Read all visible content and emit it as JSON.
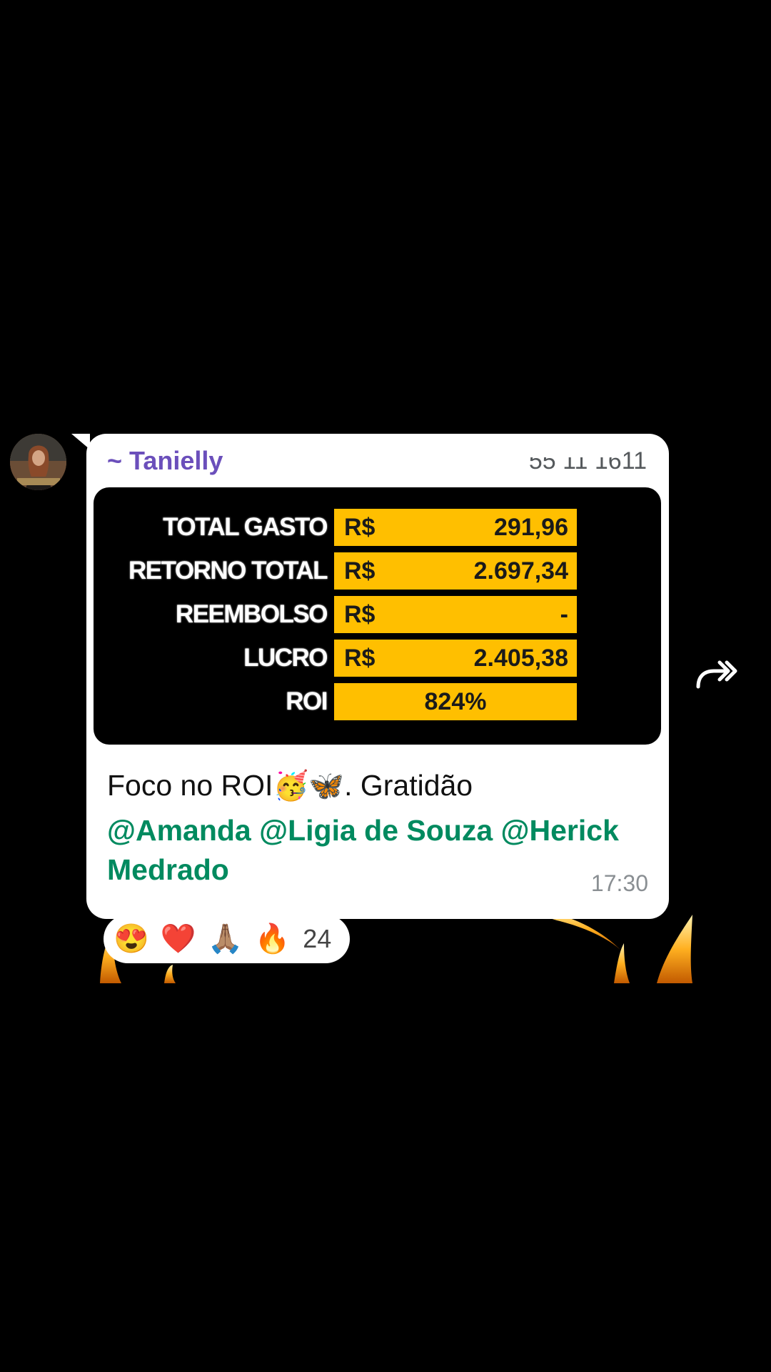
{
  "message": {
    "sender_visible": "~ Tanielly",
    "phone_fragment": "55 11 1611",
    "caption": "Foco no ROI",
    "caption_emojis": [
      "🥳",
      "🦋"
    ],
    "caption_suffix": ". Gratidão",
    "mentions": "@Amanda @Ligia de Souza @Herick Medrado",
    "time": "17:30"
  },
  "financial_table": {
    "rows": [
      {
        "label": "TOTAL GASTO",
        "currency": "R$",
        "value": "291,96"
      },
      {
        "label": "RETORNO TOTAL",
        "currency": "R$",
        "value": "2.697,34"
      },
      {
        "label": "REEMBOLSO",
        "currency": "R$",
        "value": "-"
      },
      {
        "label": "LUCRO",
        "currency": "R$",
        "value": "2.405,38"
      },
      {
        "label": "ROI",
        "currency": "",
        "value": "824%"
      }
    ]
  },
  "reactions": {
    "emojis": [
      "😍",
      "❤️",
      "🙏🏽",
      "🔥"
    ],
    "count": "24"
  },
  "icons": {
    "forward": "forward-arrow-icon",
    "avatar": "sender-avatar"
  },
  "colors": {
    "sender_name": "#6b4fbb",
    "mention": "#008a5f",
    "table_cell": "#ffbf00"
  }
}
